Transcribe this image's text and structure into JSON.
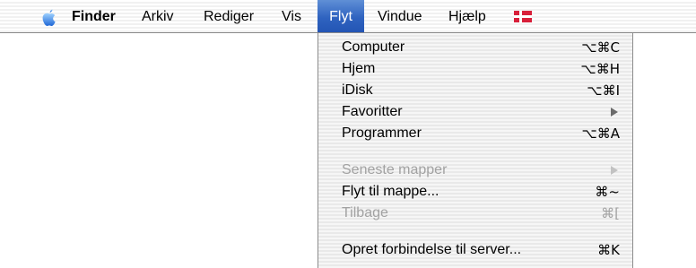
{
  "menubar": {
    "apple_icon": "apple-icon",
    "items": [
      {
        "label": "Finder"
      },
      {
        "label": "Arkiv"
      },
      {
        "label": "Rediger"
      },
      {
        "label": "Vis"
      },
      {
        "label": "Flyt"
      },
      {
        "label": "Vindue"
      },
      {
        "label": "Hjælp"
      }
    ],
    "flag_icon": "danish-flag-icon",
    "active_color": "#2f63c0"
  },
  "menu": {
    "items": [
      {
        "label": "Computer",
        "shortcut": "⌥⌘C",
        "enabled": true
      },
      {
        "label": "Hjem",
        "shortcut": "⌥⌘H",
        "enabled": true
      },
      {
        "label": "iDisk",
        "shortcut": "⌥⌘I",
        "enabled": true
      },
      {
        "label": "Favoritter",
        "submenu_icon": "submenu-arrow-icon",
        "enabled": true
      },
      {
        "label": "Programmer",
        "shortcut": "⌥⌘A",
        "enabled": true
      },
      {
        "label": "Seneste mapper",
        "submenu_icon": "submenu-arrow-icon",
        "enabled": false
      },
      {
        "label": "Flyt til mappe...",
        "shortcut": "⌘~",
        "enabled": true
      },
      {
        "label": "Tilbage",
        "shortcut": "⌘[",
        "enabled": false
      },
      {
        "label": "Opret forbindelse til server...",
        "shortcut": "⌘K",
        "enabled": true
      }
    ]
  }
}
